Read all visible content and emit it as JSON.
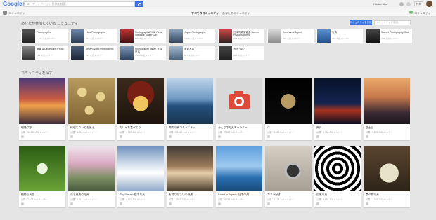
{
  "header": {
    "logo_text": "Google+",
    "search_placeholder": "ユーザー、ページ、投稿を検索",
    "user_name": "Hiroko Uno",
    "share_label": "共有"
  },
  "subnav": {
    "section_label": "コミュニティ",
    "tabs": [
      "すべてのコミュニティ",
      "あなたのコミュニティ"
    ],
    "right_label": "コミュニティ"
  },
  "my_communities": {
    "title": "あなたが参加している コミュニティ",
    "create_label": "コミュニティを作成",
    "search_placeholder": "コミュニティを検索",
    "items": [
      {
        "name": "Photographs",
        "meta": "1,234 人のメンバー"
      },
      {
        "name": "Halo Photographs",
        "meta": "567 人のメンバー"
      },
      {
        "name": "Photograph ARISE Pirate Software Maker Lab",
        "meta": "890 人のメンバー"
      },
      {
        "name": "Japan Photographs",
        "meta": "2,345 人のメンバー"
      },
      {
        "name": "日本写真家協会 Scenic Photographers",
        "meta": "678 人のメンバー"
      },
      {
        "name": "Yokohama Japan",
        "meta": "345 人のメンバー"
      },
      {
        "name": "写真",
        "meta": "456 人のメンバー"
      },
      {
        "name": "Sunset Photography Club",
        "meta": "789 人のメンバー"
      },
      {
        "name": "風景 & Landscape Photo",
        "meta": "123 人のメンバー"
      },
      {
        "name": "Japan Night Photographs",
        "meta": "234 人のメンバー"
      },
      {
        "name": "Photography Japan 写真 日本",
        "meta": "3,456 人のメンバー"
      },
      {
        "name": "風景写真",
        "meta": "567 人のメンバー"
      },
      {
        "name": "カメラ好き",
        "meta": "890 人のメンバー"
      }
    ]
  },
  "explore": {
    "title": "コミュニティを探す",
    "cards": [
      {
        "title": "朝焼け部",
        "meta": "公開 · 12,345 人のメンバー"
      },
      {
        "title": "料理とパンとお菓子",
        "meta": "公開 · 8,901 人のメンバー"
      },
      {
        "title": "カレーを食べよう",
        "meta": "公開 · 4,567 人のメンバー"
      },
      {
        "title": "海の写真コミュニティ",
        "meta": "公開 · 23,456 人のメンバー"
      },
      {
        "title": "みんなの写真ギャラリー",
        "meta": "公開 · 7,890 人のメンバー"
      },
      {
        "title": "月",
        "meta": "公開 · 3,210 人のメンバー"
      },
      {
        "title": "神戸",
        "meta": "公開 · 5,432 人のメンバー"
      },
      {
        "title": "富士山",
        "meta": "公開 · 9,876 人のメンバー"
      },
      {
        "title": "植物写真部",
        "meta": "公開 · 2,109 人のメンバー"
      },
      {
        "title": "花と風景の写真",
        "meta": "公開 · 6,543 人のメンバー"
      },
      {
        "title": "Sky Stream 空の写真",
        "meta": "公開 · 4,321 人のメンバー"
      },
      {
        "title": "お帰りなさいの風景",
        "meta": "公開 · 1,987 人のメンバー"
      },
      {
        "title": "Coast in Japan · 日本の海",
        "meta": "公開 · 8,765 人のメンバー"
      },
      {
        "title": "カメラ好き",
        "meta": "公開 · 5,678 人のメンバー"
      },
      {
        "title": "白黒写真",
        "meta": "公開 · 3,456 人のメンバー"
      },
      {
        "title": "食べ物写真",
        "meta": "公開 · 2,345 人のメンバー"
      }
    ]
  },
  "colors": {
    "accent": "#3b78e7",
    "background": "#e5e5e5"
  }
}
